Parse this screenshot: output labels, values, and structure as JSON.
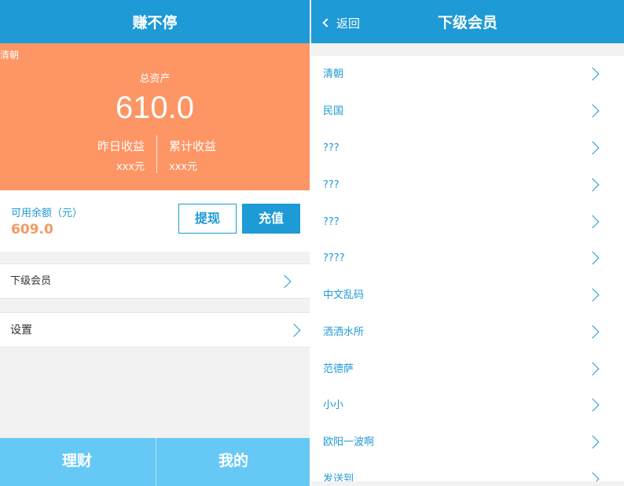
{
  "left": {
    "header_title": "赚不停",
    "hero": {
      "username": "清朝",
      "total_assets_label": "总资产",
      "total_assets_value": "610.0",
      "yesterday_label": "昨日收益",
      "yesterday_value": "xxx元",
      "cumulative_label": "累计收益",
      "cumulative_value": "xxx元"
    },
    "balance": {
      "label": "可用余额（元）",
      "value": "609.0",
      "withdraw_label": "提现",
      "recharge_label": "充值"
    },
    "menu": {
      "subordinate_label": "下级会员",
      "settings_label": "设置"
    },
    "tabs": {
      "finance_label": "理财",
      "mine_label": "我的"
    }
  },
  "right": {
    "back_label": "返回",
    "title": "下级会员",
    "members": [
      "清朝",
      "民国",
      "???",
      "???",
      "???",
      "????",
      "中文乱码",
      "洒洒水所",
      "范德萨",
      "小小",
      "欧阳一波啊",
      "发送到"
    ]
  },
  "colors": {
    "primary": "#1e9ad6",
    "hero_orange": "#fd9565",
    "balance_orange": "#f29a63",
    "tabbar": "#66c8f5"
  }
}
